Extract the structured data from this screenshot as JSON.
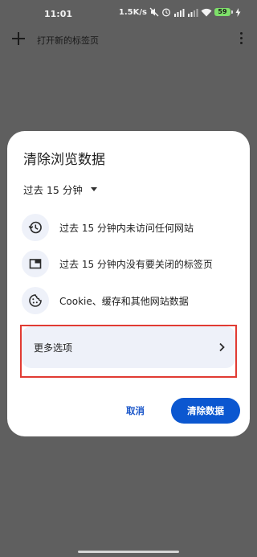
{
  "status_bar": {
    "time": "11:01",
    "network_speed": "1.5K/s",
    "battery_level": "59",
    "icons": [
      "mute-icon",
      "alarm-icon",
      "hd-signal-icon",
      "hd-signal-icon",
      "wifi-icon",
      "battery-icon",
      "charging-icon"
    ]
  },
  "toolbar": {
    "new_tab_title": "打开新的标签页",
    "icons": [
      "plus-icon",
      "more-vert-icon"
    ]
  },
  "dialog": {
    "title": "清除浏览数据",
    "time_range": "过去 15 分钟",
    "items": [
      {
        "icon": "history-icon",
        "label": "过去 15 分钟内未访问任何网站"
      },
      {
        "icon": "tab-icon",
        "label": "过去 15 分钟内没有要关闭的标签页"
      },
      {
        "icon": "cookie-icon",
        "label": "Cookie、缓存和其他网站数据"
      }
    ],
    "more_options_label": "更多选项",
    "cancel_label": "取消",
    "clear_label": "清除数据"
  },
  "colors": {
    "scrim": "#5f5f5f",
    "dialog_bg": "#ffffff",
    "icon_circle": "#eef1f9",
    "primary_button": "#0b57d0",
    "cancel_text": "#1a56c9",
    "highlight_border": "#e13b33"
  }
}
